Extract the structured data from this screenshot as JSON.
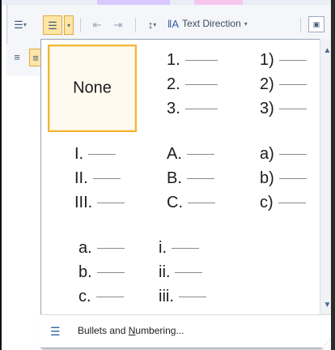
{
  "toolbar": {
    "text_direction_label": "Text Direction",
    "dropdown_arrow": "▾"
  },
  "gallery": {
    "none_label": "None",
    "number_paren": [
      "1)",
      "2)",
      "3)"
    ],
    "number_dot": [
      "1.",
      "2.",
      "3."
    ],
    "roman_upper": [
      "I.",
      "II.",
      "III."
    ],
    "alpha_upper": [
      "A.",
      "B.",
      "C."
    ],
    "alpha_paren": [
      "a)",
      "b)",
      "c)"
    ],
    "alpha_lower": [
      "a.",
      "b.",
      "c."
    ],
    "roman_lower": [
      "i.",
      "ii.",
      "iii."
    ]
  },
  "footer": {
    "label_before": "Bullets and ",
    "label_underlined": "N",
    "label_after": "umbering..."
  },
  "icons": {
    "bullets": "bullets-icon",
    "numbering": "numbering-icon",
    "decrease_indent": "decrease-indent-icon",
    "increase_indent": "increase-indent-icon",
    "line_spacing": "line-spacing-icon",
    "text_direction": "text-direction-icon",
    "align_left": "align-left-icon",
    "scroll_up": "scroll-up-icon",
    "scroll_down": "scroll-down-icon"
  },
  "colors": {
    "selected_border": "#f3b434",
    "active_button": "#fde6a6",
    "panel_border": "#9aa6b8"
  }
}
